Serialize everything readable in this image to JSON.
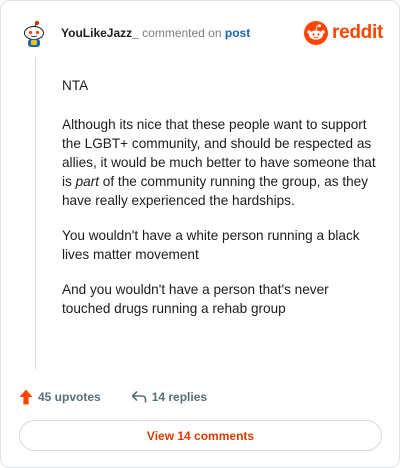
{
  "comment": {
    "username": "YouLikeJazz_",
    "action_text": "commented on",
    "post_link": "post",
    "paragraphs": [
      "NTA",
      "You wouldn't have a white person running a black lives matter movement",
      "And you wouldn't have a person that's never touched drugs running a rehab group"
    ],
    "p2": {
      "before": "Although its nice that these people want to support the LGBT+ community, and should be respected as allies, it would be much better to have someone that is ",
      "italic": "part",
      "after": " of the community running the group, as they have really experienced the hardships."
    }
  },
  "brand": {
    "wordmark": "reddit",
    "color": "#ff4500"
  },
  "actions": {
    "upvotes_label": "45 upvotes",
    "replies_label": "14 replies",
    "upvote_icon": "upvote-arrow-icon",
    "reply_icon": "reply-arrow-icon"
  },
  "footer": {
    "view_comments_label": "View 14 comments"
  },
  "colors": {
    "accent": "#ff4500",
    "link": "#1b62b7",
    "muted": "#576f76"
  }
}
